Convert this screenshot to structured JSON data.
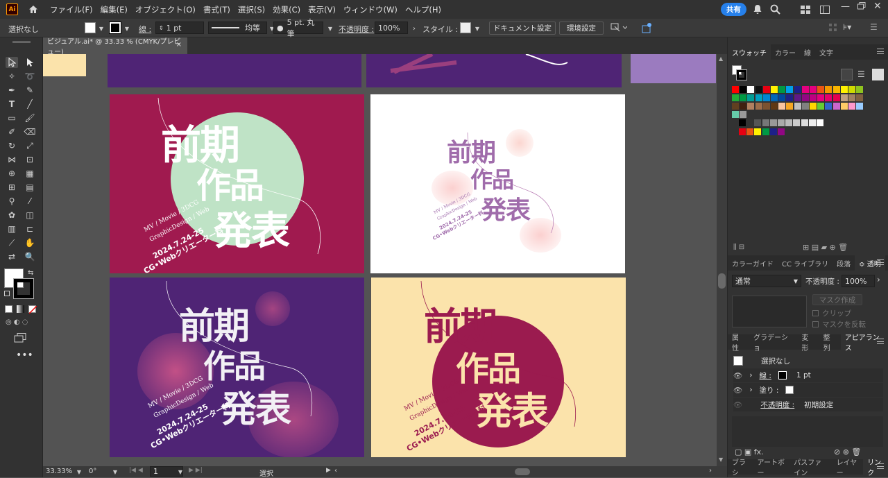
{
  "app": {
    "logo": "Ai"
  },
  "menu": [
    "ファイル(F)",
    "編集(E)",
    "オブジェクト(O)",
    "書式(T)",
    "選択(S)",
    "効果(C)",
    "表示(V)",
    "ウィンドウ(W)",
    "ヘルプ(H)"
  ],
  "share_label": "共有",
  "control": {
    "selection": "選択なし",
    "stroke_label": "線 :",
    "stroke_value": "1 pt",
    "profile_label": "均等",
    "brush_label": "5 pt. 丸筆",
    "opacity_label": "不透明度 :",
    "opacity_value": "100%",
    "style_label": "スタイル :",
    "doc_setup": "ドキュメント設定",
    "prefs": "環境設定"
  },
  "tab": {
    "title": "ビジュアル.ai* @ 33.33 % (CMYK/プレビュー)",
    "close": "×"
  },
  "posters": {
    "title_line1": "前期",
    "title_line2": "作品",
    "title_line3": "発表",
    "sub1": "MV / Movie / 3DCG",
    "sub2": "GraphicDesign / Web",
    "date": "2024.7.24-25",
    "dept": "CG•Webクリエーター科"
  },
  "status": {
    "zoom": "33.33%",
    "rotation": "0°",
    "artboard": "1",
    "mode": "選択"
  },
  "swatch_panel": {
    "tabs": [
      "スウォッチ",
      "カラー",
      "線",
      "文字"
    ]
  },
  "transparency_panel": {
    "tabs": [
      "カラーガイド",
      "CC ライブラリ",
      "段落",
      "≎ 透明"
    ],
    "blend": "通常",
    "opacity_label": "不透明度 :",
    "opacity_value": "100%",
    "make_mask": "マスク作成",
    "clip": "クリップ",
    "invert": "マスクを反転"
  },
  "appearance_panel": {
    "tabs": [
      "属性",
      "グラデーショ",
      "変形",
      "整列",
      "アピアランス"
    ],
    "title": "選択なし",
    "stroke_label": "線 :",
    "stroke_value": "1 pt",
    "fill_label": "塗り :",
    "opacity_label": "不透明度 :",
    "opacity_value": "初期設定"
  },
  "bottom_tabs": [
    "ブラシ",
    "アートボー",
    "パスファイン",
    "レイヤー",
    "リンク"
  ],
  "colors": {
    "magenta_bg": "#a01a4f",
    "mint": "#bfe3c6",
    "purple_bg": "#4f2475",
    "cream_bg": "#fbe3ab",
    "crimson": "#9b1b4f",
    "lavender": "#9b7bbf"
  }
}
